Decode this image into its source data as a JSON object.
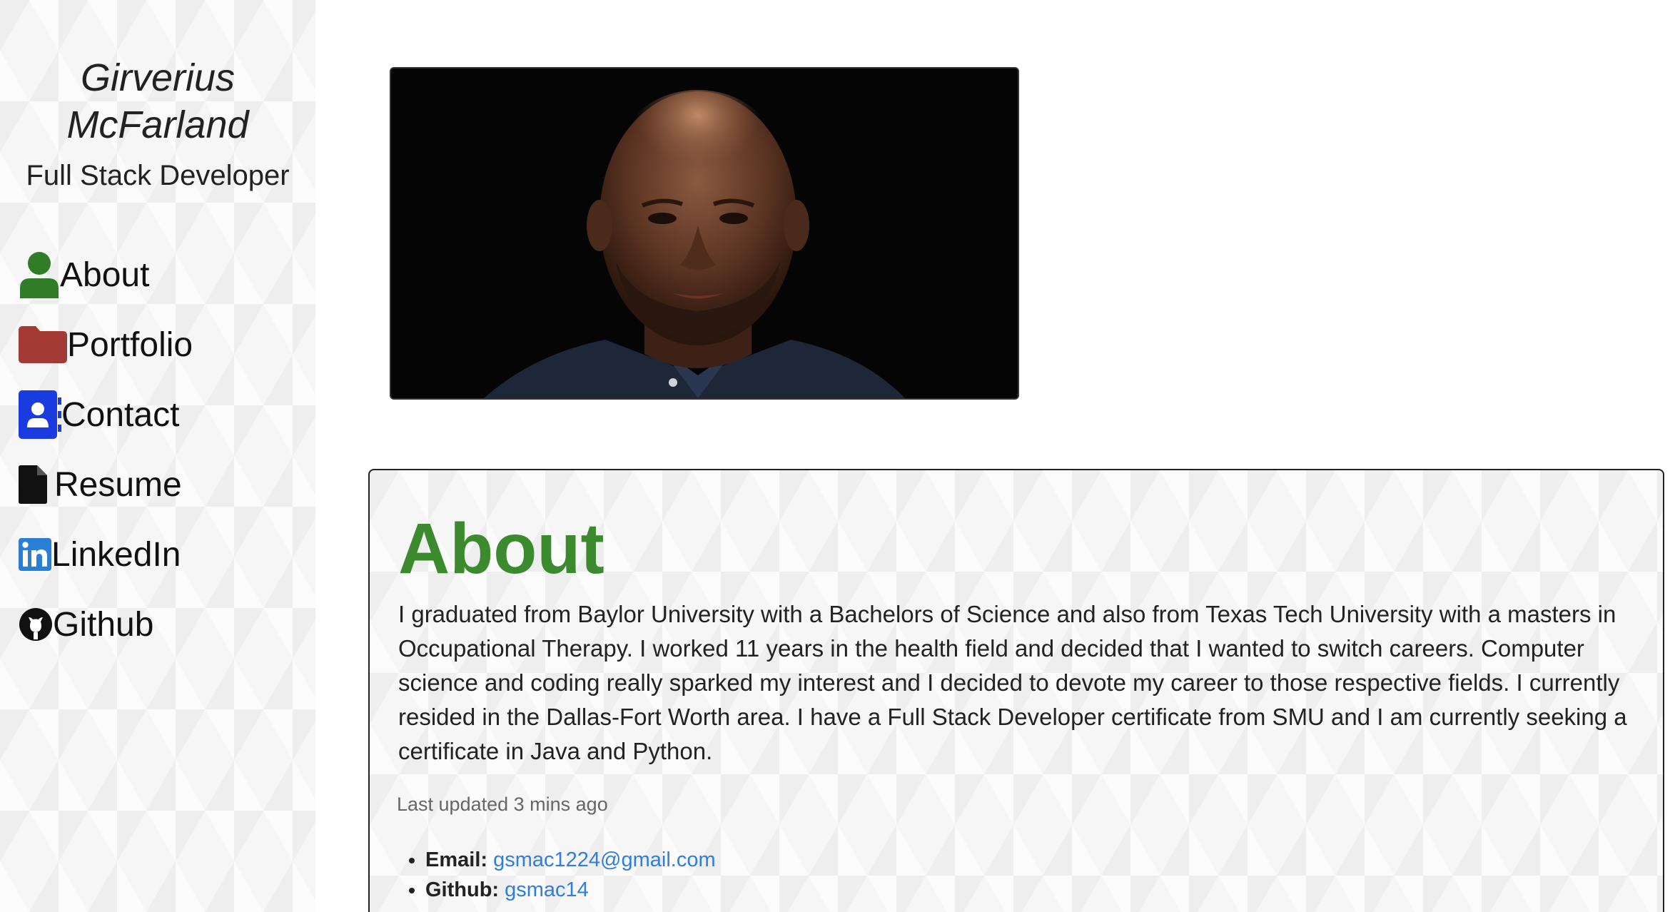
{
  "sidebar": {
    "name_line1": "Girverius",
    "name_line2": "McFarland",
    "subtitle": "Full Stack Developer",
    "nav": [
      {
        "label": "About",
        "icon": "user-icon",
        "color": "#2f7d28"
      },
      {
        "label": "Portfolio",
        "icon": "folder-icon",
        "color": "#a33a33"
      },
      {
        "label": "Contact",
        "icon": "contact-card-icon",
        "color": "#1a3be0"
      },
      {
        "label": "Resume",
        "icon": "file-icon",
        "color": "#111111"
      },
      {
        "label": "LinkedIn",
        "icon": "linkedin-icon",
        "color": "#2a7fd4"
      },
      {
        "label": "Github",
        "icon": "github-icon",
        "color": "#111111"
      }
    ]
  },
  "about": {
    "title": "About",
    "title_color": "#3c8a2e",
    "body": "I graduated from Baylor University with a Bachelors of Science and also from Texas Tech University with a masters in Occupational Therapy. I worked 11 years in the health field and decided that I wanted to switch careers. Computer science and coding really sparked my interest and I decided to devote my career to those respective fields. I currently resided in the Dallas-Fort Worth area. I have a Full Stack Developer certificate from SMU and I am currently seeking a certificate in Java and Python.",
    "updated": "Last updated 3 mins ago",
    "email_label": "Email:",
    "email_value": "gsmac1224@gmail.com",
    "github_label": "Github:",
    "github_value": "gsmac14"
  }
}
